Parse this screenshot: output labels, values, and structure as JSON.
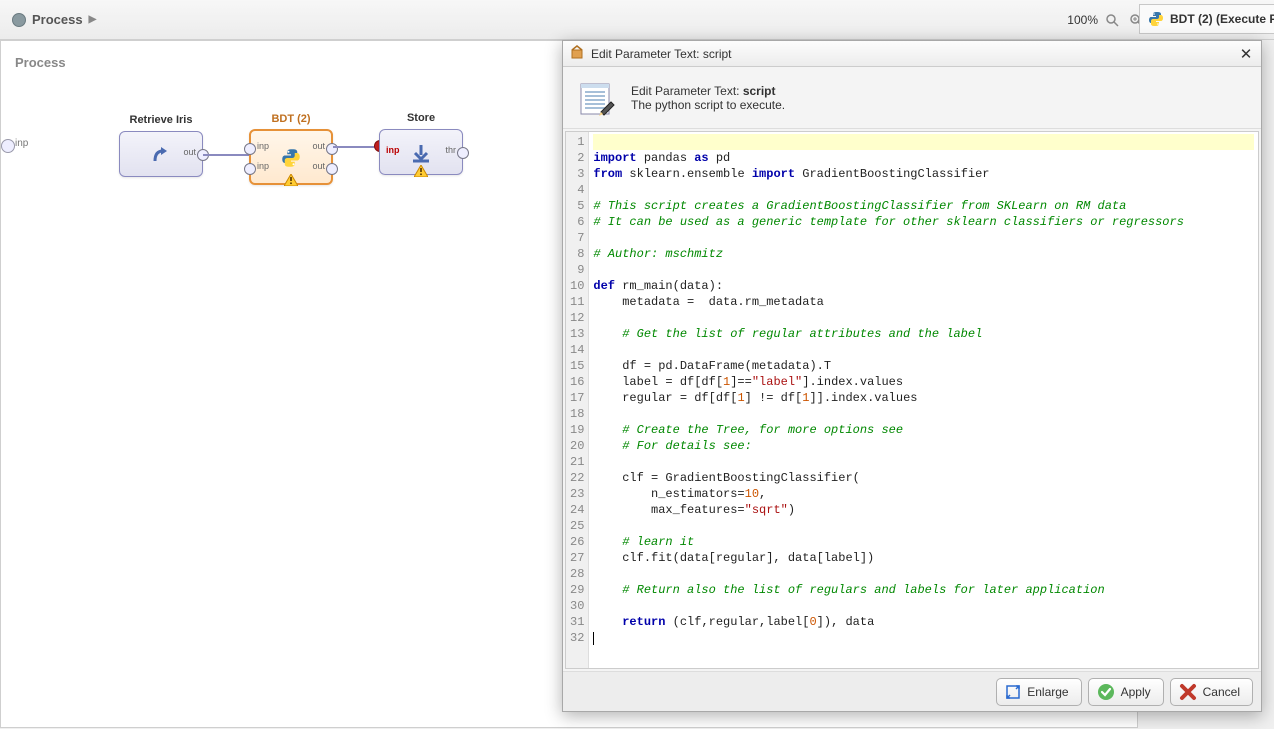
{
  "breadcrumb": {
    "title": "Process"
  },
  "zoom": {
    "label": "100%"
  },
  "rightTab": {
    "label": "BDT (2) (Execute P"
  },
  "canvas": {
    "label": "Process",
    "startPort": "inp",
    "op_retrieve": {
      "title": "Retrieve Iris",
      "out": "out"
    },
    "op_bdt": {
      "title": "BDT (2)",
      "in1": "inp",
      "in2": "inp",
      "out1": "out",
      "out2": "out"
    },
    "op_store": {
      "title": "Store",
      "in": "inp",
      "out": "thr"
    }
  },
  "dialog": {
    "titlebar": "Edit Parameter Text: script",
    "header_title_prefix": "Edit Parameter Text: ",
    "header_title_bold": "script",
    "header_sub": "The python script to execute.",
    "buttons": {
      "enlarge": "Enlarge",
      "apply": "Apply",
      "cancel": "Cancel"
    },
    "code_lines": [
      "",
      "import pandas as pd",
      "from sklearn.ensemble import GradientBoostingClassifier",
      "",
      "# This script creates a GradientBoostingClassifier from SKLearn on RM data",
      "# It can be used as a generic template for other sklearn classifiers or regressors",
      "",
      "# Author: mschmitz",
      "",
      "def rm_main(data):",
      "    metadata =  data.rm_metadata",
      "",
      "    # Get the list of regular attributes and the label",
      "",
      "    df = pd.DataFrame(metadata).T",
      "    label = df[df[1]==\"label\"].index.values",
      "    regular = df[df[1] != df[1]].index.values",
      "",
      "    # Create the Tree, for more options see",
      "    # For details see:",
      "",
      "    clf = GradientBoostingClassifier(",
      "        n_estimators=10,",
      "        max_features=\"sqrt\")",
      "",
      "    # learn it",
      "    clf.fit(data[regular], data[label])",
      "",
      "    # Return also the list of regulars and labels for later application",
      "",
      "    return (clf,regular,label[0]), data",
      ""
    ]
  }
}
